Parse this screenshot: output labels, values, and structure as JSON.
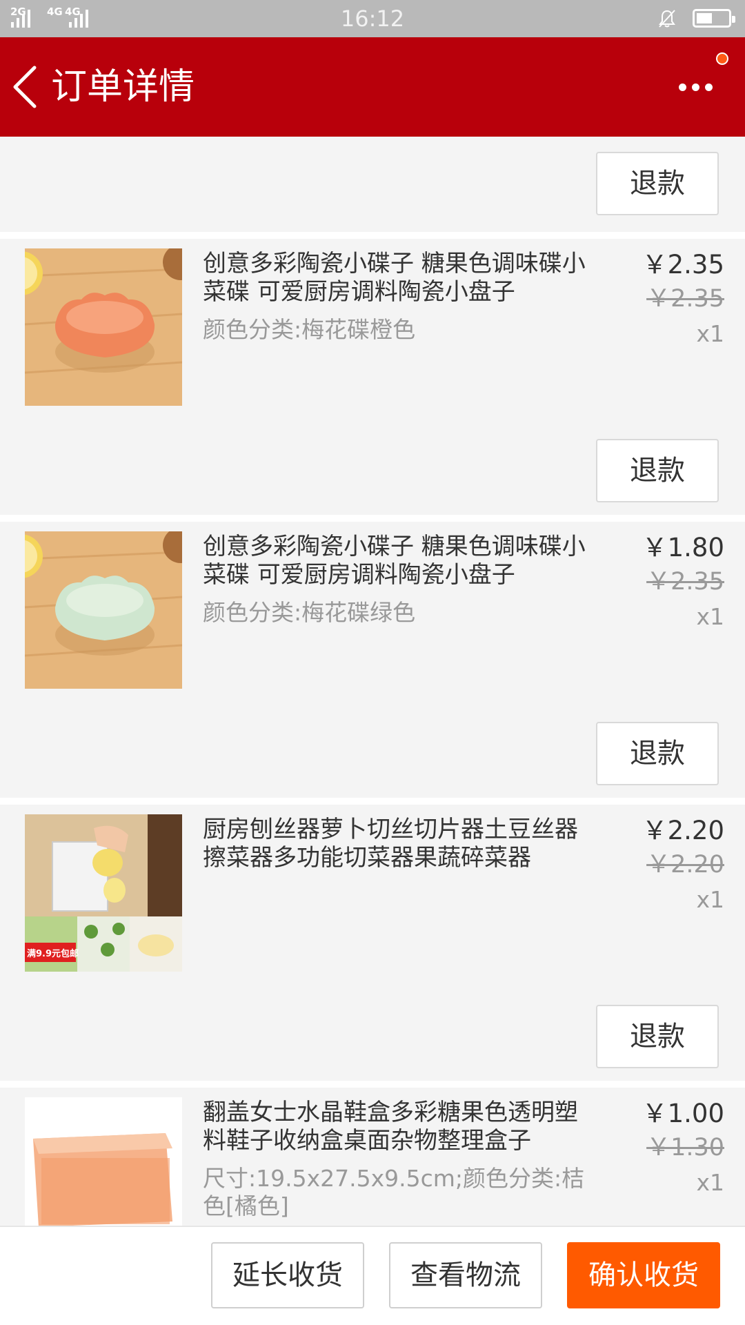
{
  "status_bar": {
    "net1": "2G",
    "net2": "4G",
    "net3": "4G",
    "time": "16:12"
  },
  "header": {
    "title": "订单详情"
  },
  "refund_label": "退款",
  "items": [
    {
      "name": "创意多彩陶瓷小碟子 糖果色调味碟小菜碟 可爱厨房调料陶瓷小盘子",
      "spec": "颜色分类:梅花碟橙色",
      "price": "￥2.35",
      "original_price": "￥2.35",
      "quantity": "x1",
      "bowl_color": "#f0865a"
    },
    {
      "name": "创意多彩陶瓷小碟子 糖果色调味碟小菜碟 可爱厨房调料陶瓷小盘子",
      "spec": "颜色分类:梅花碟绿色",
      "price": "￥1.80",
      "original_price": "￥2.35",
      "quantity": "x1",
      "bowl_color": "#cfe6cf"
    },
    {
      "name": "厨房刨丝器萝卜切丝切片器土豆丝器擦菜器多功能切菜器果蔬碎菜器",
      "spec": "",
      "price": "￥2.20",
      "original_price": "￥2.20",
      "quantity": "x1",
      "badge": "满9.9元包邮"
    },
    {
      "name": "翻盖女士水晶鞋盒多彩糖果色透明塑料鞋子收纳盒桌面杂物整理盒子",
      "spec": "尺寸:19.5x27.5x9.5cm;颜色分类:桔色[橘色]",
      "price": "￥1.00",
      "original_price": "￥1.30",
      "quantity": "x1"
    }
  ],
  "bottom_bar": {
    "extend_label": "延长收货",
    "logistics_label": "查看物流",
    "confirm_label": "确认收货"
  },
  "colors": {
    "header_bg": "#b8000b",
    "primary_button": "#ff5a00",
    "notification_dot": "#ff5a16"
  }
}
